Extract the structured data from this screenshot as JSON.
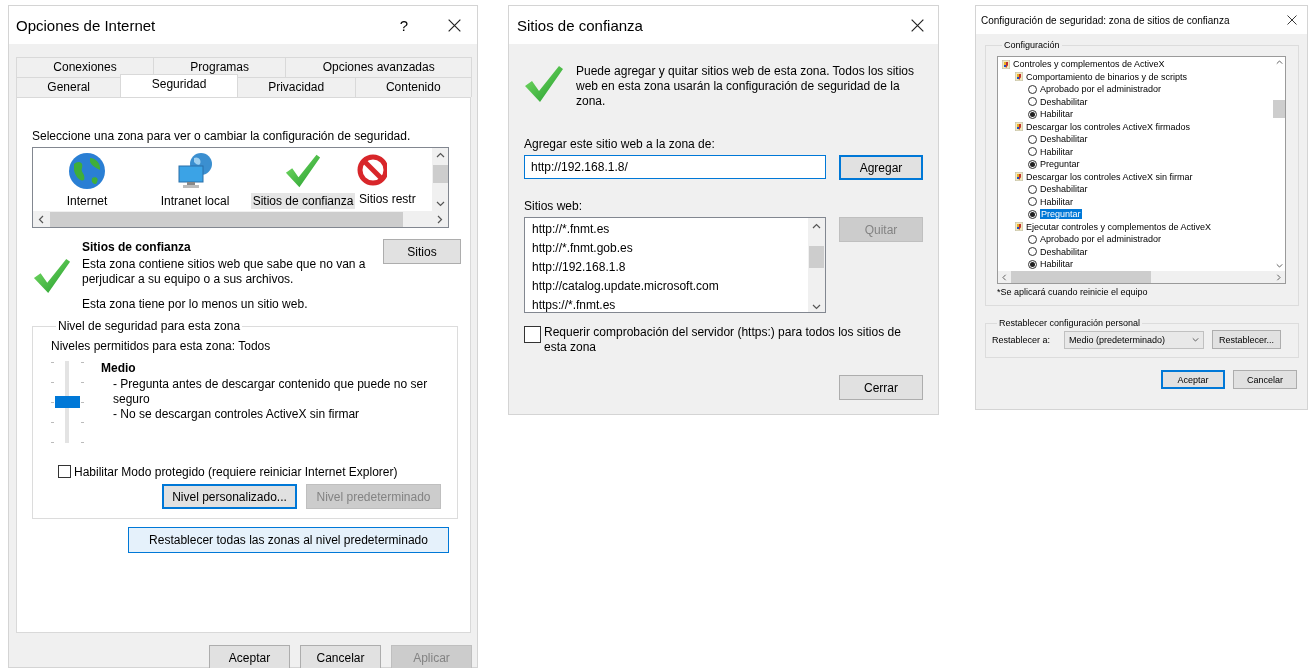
{
  "internet_options": {
    "title": "Opciones de Internet",
    "help": "?",
    "tab_rows": [
      [
        {
          "label": "Conexiones",
          "selected": false
        },
        {
          "label": "Programas",
          "selected": false
        },
        {
          "label": "Opciones avanzadas",
          "selected": false
        }
      ],
      [
        {
          "label": "General",
          "selected": false
        },
        {
          "label": "Seguridad",
          "selected": true
        },
        {
          "label": "Privacidad",
          "selected": false
        },
        {
          "label": "Contenido",
          "selected": false
        }
      ]
    ],
    "zone_prompt": "Seleccione una zona para ver o cambiar la configuración de seguridad.",
    "zones": [
      {
        "kind": "globe",
        "label": "Internet",
        "selected": false
      },
      {
        "kind": "intranet",
        "label": "Intranet local",
        "selected": false
      },
      {
        "kind": "trusted",
        "label": "Sitios de confianza",
        "selected": true
      },
      {
        "kind": "restricted",
        "label": "Sitios restr",
        "selected": false
      }
    ],
    "zone_detail": {
      "title": "Sitios de confianza",
      "description": "Esta zona contiene sitios web que sabe que no van a perjudicar a su equipo o a sus archivos.",
      "note": "Esta zona tiene por lo menos un sitio web.",
      "button": {
        "label": "Sitios",
        "disabled": false,
        "focused": false
      }
    },
    "security_level": {
      "legend": "Nivel de seguridad para esta zona",
      "allowed": "Niveles permitidos para esta zona: Todos",
      "level": 0.5,
      "name": "Medio",
      "details": [
        "- Pregunta antes de descargar contenido que puede no ser seguro",
        "- No se descargan controles ActiveX sin firmar"
      ],
      "protected_mode": {
        "label": "Habilitar Modo protegido (requiere reiniciar Internet Explorer)",
        "checked": false
      },
      "buttons": [
        {
          "label": "Nivel personalizado...",
          "disabled": false,
          "focused": true
        },
        {
          "label": "Nivel predeterminado",
          "disabled": true,
          "focused": false
        }
      ]
    },
    "reset_all": "Restablecer todas las zonas al nivel predeterminado",
    "footer": [
      {
        "label": "Aceptar",
        "disabled": false,
        "focused": false
      },
      {
        "label": "Cancelar",
        "disabled": false,
        "focused": false
      },
      {
        "label": "Aplicar",
        "disabled": true,
        "focused": false
      }
    ]
  },
  "trusted_sites": {
    "title": "Sitios de confianza",
    "description": "Puede agregar y quitar sitios web de esta zona. Todos los sitios web en esta zona usarán la configuración de seguridad de la zona.",
    "add_label": "Agregar este sitio web a la zona de:",
    "add_value": "http://192.168.1.8/",
    "add_button": {
      "label": "Agregar",
      "disabled": false,
      "focused": true
    },
    "sites_label": "Sitios web:",
    "sites": [
      "http://*.fnmt.es",
      "http://*.fnmt.gob.es",
      "http://192.168.1.8",
      "http://catalog.update.microsoft.com",
      "https://*.fnmt.es"
    ],
    "remove_button": {
      "label": "Quitar",
      "disabled": true,
      "focused": false
    },
    "require_https": {
      "label": "Requerir comprobación del servidor (https:) para todos los sitios de esta zona",
      "checked": false
    },
    "close_button": {
      "label": "Cerrar",
      "disabled": false,
      "focused": false
    }
  },
  "security_settings": {
    "title": "Configuración de seguridad: zona de sitios de confianza",
    "group": "Configuración",
    "tree": [
      {
        "kind": "category",
        "label": "Controles y complementos de ActiveX",
        "children": [
          {
            "kind": "setting",
            "label": "Comportamiento de binarios y de scripts",
            "children": [
              {
                "kind": "option",
                "label": "Aprobado por el administrador",
                "selected": false,
                "highlighted": false
              },
              {
                "kind": "option",
                "label": "Deshabilitar",
                "selected": false,
                "highlighted": false
              },
              {
                "kind": "option",
                "label": "Habilitar",
                "selected": true,
                "highlighted": false
              }
            ]
          },
          {
            "kind": "setting",
            "label": "Descargar los controles ActiveX firmados",
            "children": [
              {
                "kind": "option",
                "label": "Deshabilitar",
                "selected": false,
                "highlighted": false
              },
              {
                "kind": "option",
                "label": "Habilitar",
                "selected": false,
                "highlighted": false
              },
              {
                "kind": "option",
                "label": "Preguntar",
                "selected": true,
                "highlighted": false
              }
            ]
          },
          {
            "kind": "setting",
            "label": "Descargar los controles ActiveX sin firmar",
            "children": [
              {
                "kind": "option",
                "label": "Deshabilitar",
                "selected": false,
                "highlighted": false
              },
              {
                "kind": "option",
                "label": "Habilitar",
                "selected": false,
                "highlighted": false
              },
              {
                "kind": "option",
                "label": "Preguntar",
                "selected": true,
                "highlighted": true
              }
            ]
          },
          {
            "kind": "setting",
            "label": "Ejecutar controles y complementos de ActiveX",
            "children": [
              {
                "kind": "option",
                "label": "Aprobado por el administrador",
                "selected": false,
                "highlighted": false
              },
              {
                "kind": "option",
                "label": "Deshabilitar",
                "selected": false,
                "highlighted": false
              },
              {
                "kind": "option",
                "label": "Habilitar",
                "selected": true,
                "highlighted": false
              }
            ]
          }
        ]
      }
    ],
    "note": "*Se aplicará cuando reinicie el equipo",
    "reset_group": "Restablecer configuración personal",
    "reset_label": "Restablecer a:",
    "reset_value": "Medio (predeterminado)",
    "reset_button": {
      "label": "Restablecer...",
      "disabled": false,
      "focused": false
    },
    "buttons": [
      {
        "label": "Aceptar",
        "disabled": false,
        "focused": true
      },
      {
        "label": "Cancelar",
        "disabled": false,
        "focused": false
      }
    ]
  }
}
